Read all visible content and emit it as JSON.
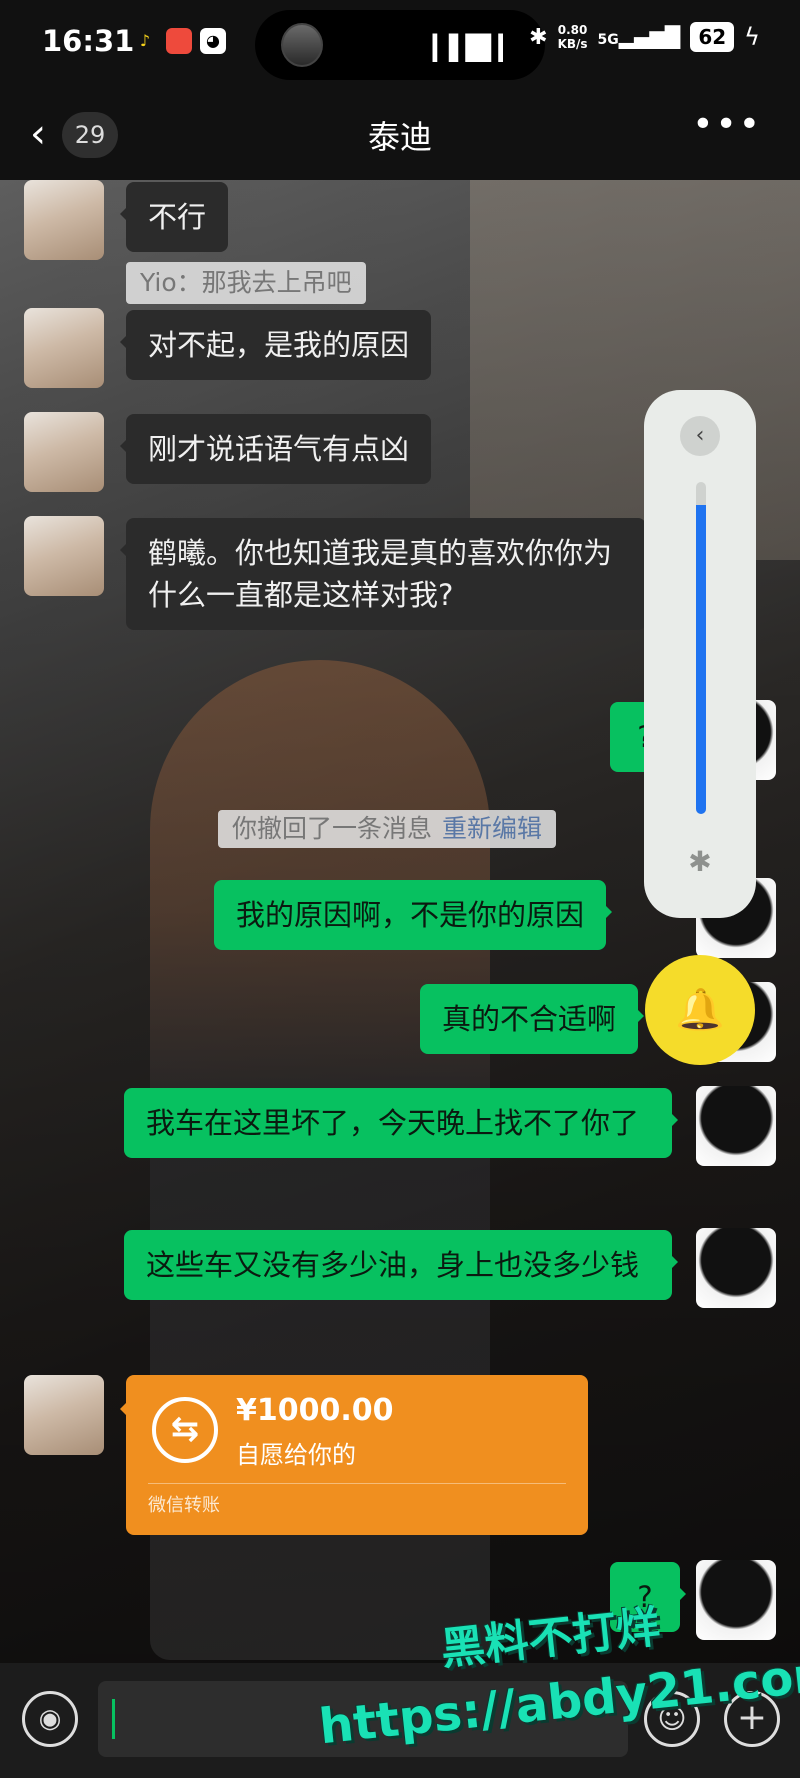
{
  "status_bar": {
    "time": "16:31",
    "network_speed": "0.80",
    "network_unit": "KB/s",
    "signal": "5G",
    "battery": "62"
  },
  "nav": {
    "unread_count": "29",
    "title": "泰迪"
  },
  "messages": [
    {
      "side": "in",
      "text": "不行"
    },
    {
      "side": "system",
      "text": "Yio：那我去上吊吧"
    },
    {
      "side": "in",
      "text": "对不起，是我的原因"
    },
    {
      "side": "in",
      "text": "刚才说话语气有点凶"
    },
    {
      "side": "in",
      "text": "鹤曦。你也知道我是真的喜欢你你为什么一直都是这样对我?"
    },
    {
      "side": "out",
      "text": "?"
    },
    {
      "side": "system",
      "text": "你撤回了一条消息",
      "action": "重新编辑"
    },
    {
      "side": "out",
      "text": "我的原因啊，不是你的原因"
    },
    {
      "side": "out",
      "text": "真的不合适啊"
    },
    {
      "side": "out",
      "text": "我车在这里坏了，今天晚上找不了你了"
    },
    {
      "side": "out",
      "text": "这些车又没有多少油，身上也没多少钱"
    },
    {
      "side": "out",
      "text": "?"
    }
  ],
  "transfer": {
    "amount": "¥1000.00",
    "note": "自愿给你的",
    "label": "微信转账"
  },
  "volume": {
    "level": 0.93
  },
  "input": {
    "value": ""
  },
  "watermark": {
    "line1": "黑料不打烊",
    "line2": "https://abdy21.com"
  },
  "colors": {
    "outgoing_bubble": "#07c160",
    "incoming_bubble": "#2b2b2b",
    "transfer_card": "#f08f1f",
    "volume_fill": "#1f73f0",
    "bell_button": "#f5dc2a",
    "watermark": "#19e1b5"
  }
}
